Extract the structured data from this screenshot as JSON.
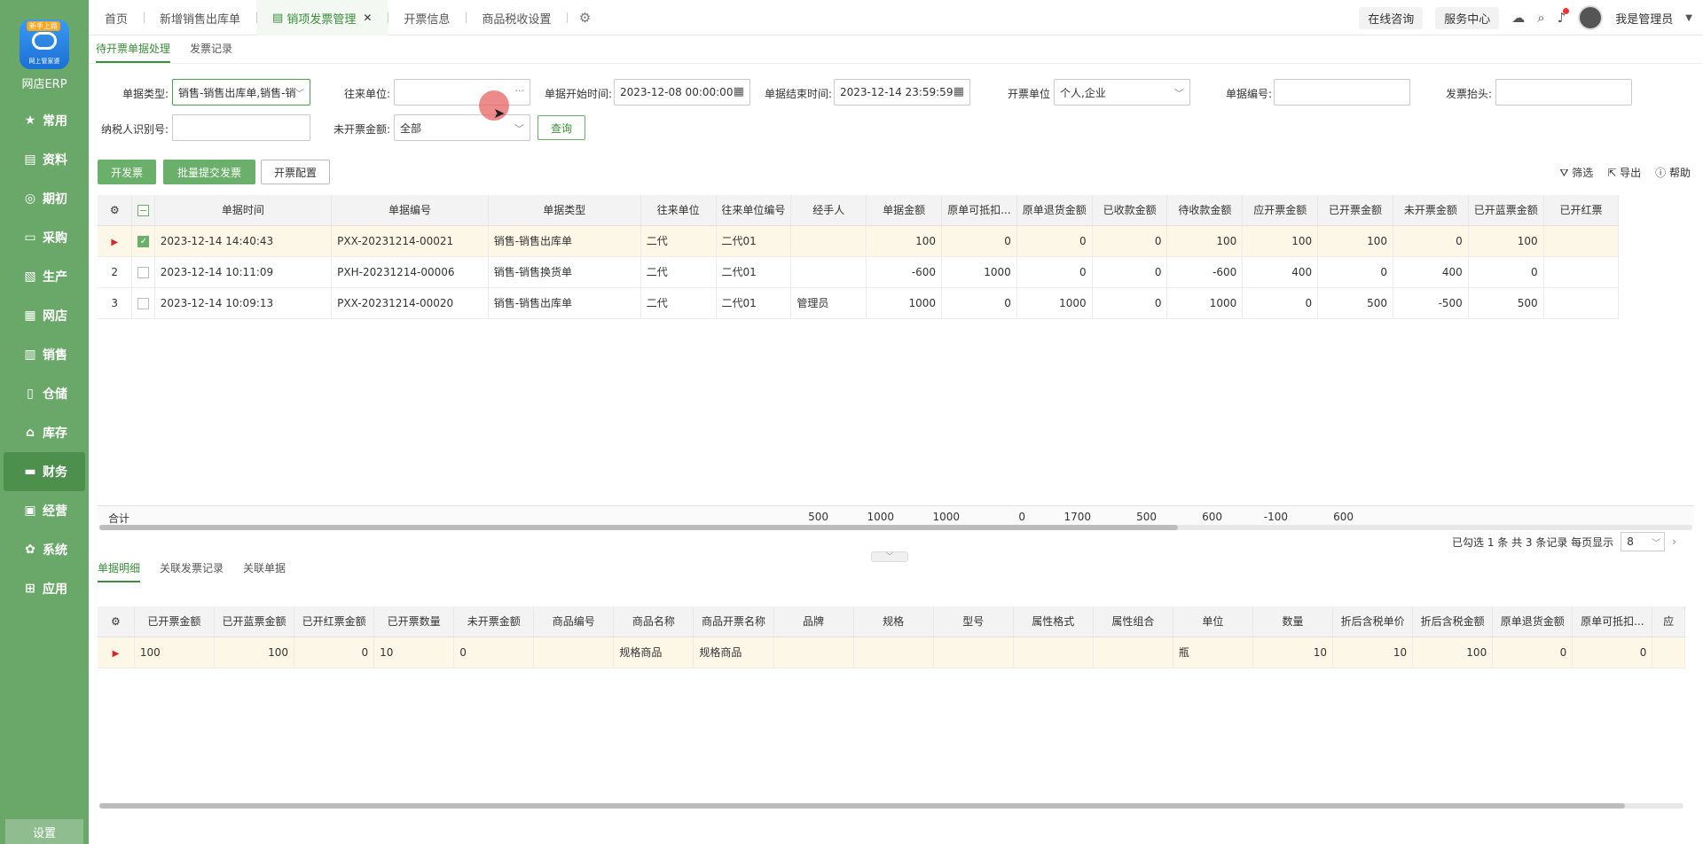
{
  "app": {
    "logo_badge": "新手上路",
    "logo_caption": "网上管家婆",
    "name": "网店ERP",
    "settings": "设置"
  },
  "nav": [
    {
      "label": "常用",
      "icon": "star-icon",
      "glyph": "★",
      "active": false
    },
    {
      "label": "资料",
      "icon": "document-icon",
      "glyph": "▤",
      "active": false
    },
    {
      "label": "期初",
      "icon": "cycle-icon",
      "glyph": "◎",
      "active": false
    },
    {
      "label": "采购",
      "icon": "monitor-icon",
      "glyph": "▭",
      "active": false
    },
    {
      "label": "生产",
      "icon": "file-icon",
      "glyph": "▧",
      "active": false
    },
    {
      "label": "网店",
      "icon": "store-icon",
      "glyph": "▦",
      "active": false
    },
    {
      "label": "销售",
      "icon": "chart-icon",
      "glyph": "▥",
      "active": false
    },
    {
      "label": "仓储",
      "icon": "warehouse-icon",
      "glyph": "▯",
      "active": false
    },
    {
      "label": "库存",
      "icon": "home-icon",
      "glyph": "⌂",
      "active": false
    },
    {
      "label": "财务",
      "icon": "wallet-icon",
      "glyph": "▬",
      "active": true
    },
    {
      "label": "经营",
      "icon": "image-icon",
      "glyph": "▣",
      "active": false
    },
    {
      "label": "系统",
      "icon": "gear-icon",
      "glyph": "✿",
      "active": false
    },
    {
      "label": "应用",
      "icon": "plus-square-icon",
      "glyph": "⊞",
      "active": false
    }
  ],
  "tabs": [
    {
      "label": "首页",
      "active": false
    },
    {
      "label": "新增销售出库单",
      "active": false
    },
    {
      "label": "销项发票管理",
      "active": true
    },
    {
      "label": "开票信息",
      "active": false
    },
    {
      "label": "商品税收设置",
      "active": false
    }
  ],
  "topright": {
    "consult": "在线咨询",
    "service": "服务中心",
    "user": "我是管理员"
  },
  "subtabs": [
    {
      "label": "待开票单据处理",
      "active": true
    },
    {
      "label": "发票记录",
      "active": false
    }
  ],
  "filters": {
    "doc_type_label": "单据类型:",
    "doc_type_value": "销售-销售出库单,销售-销",
    "partner_label": "往来单位:",
    "partner_value": "",
    "start_label": "单据开始时间:",
    "start_value": "2023-12-08 00:00:00",
    "end_label": "单据结束时间:",
    "end_value": "2023-12-14 23:59:59",
    "invoice_unit_label": "开票单位",
    "invoice_unit_value": "个人,企业",
    "doc_no_label": "单据编号:",
    "doc_no_value": "",
    "title_label": "发票抬头:",
    "title_value": "",
    "taxid_label": "纳税人识别号:",
    "taxid_value": "",
    "uninvoiced_label": "未开票金额:",
    "uninvoiced_value": "全部",
    "query": "查询"
  },
  "actions": {
    "issue": "开发票",
    "batch": "批量提交发票",
    "config": "开票配置",
    "filter": "筛选",
    "export": "导出",
    "help": "帮助"
  },
  "main_table": {
    "headers": [
      "单据时间",
      "单据编号",
      "单据类型",
      "往来单位",
      "往来单位编号",
      "经手人",
      "单据金额",
      "原单可抵扣...",
      "原单退货金额",
      "已收款金额",
      "待收款金额",
      "应开票金额",
      "已开票金额",
      "未开票金额",
      "已开蓝票金额",
      "已开红票"
    ],
    "rows": [
      {
        "no": "",
        "selected": true,
        "cells": [
          "2023-12-14 14:40:43",
          "PXX-20231214-00021",
          "销售-销售出库单",
          "二代",
          "二代01",
          "",
          "100",
          "0",
          "0",
          "0",
          "100",
          "100",
          "100",
          "0",
          "100",
          ""
        ]
      },
      {
        "no": "2",
        "selected": false,
        "cells": [
          "2023-12-14 10:11:09",
          "PXH-20231214-00006",
          "销售-销售换货单",
          "二代",
          "二代01",
          "",
          "-600",
          "1000",
          "0",
          "0",
          "-600",
          "400",
          "0",
          "400",
          "0",
          ""
        ]
      },
      {
        "no": "3",
        "selected": false,
        "cells": [
          "2023-12-14 10:09:13",
          "PXX-20231214-00020",
          "销售-销售出库单",
          "二代",
          "二代01",
          "管理员",
          "1000",
          "0",
          "1000",
          "0",
          "1000",
          "0",
          "500",
          "-500",
          "500",
          ""
        ]
      }
    ],
    "summary_label": "合计",
    "summary": [
      "500",
      "1000",
      "1000",
      "0",
      "1700",
      "500",
      "600",
      "-100",
      "600"
    ]
  },
  "pager": {
    "info": "已勾选 1 条  共 3 条记录  每页显示",
    "size": "8"
  },
  "bottom_tabs": [
    {
      "label": "单据明细",
      "active": true
    },
    {
      "label": "关联发票记录",
      "active": false
    },
    {
      "label": "关联单据",
      "active": false
    }
  ],
  "detail_table": {
    "headers": [
      "已开票金额",
      "已开蓝票金额",
      "已开红票金额",
      "已开票数量",
      "未开票金额",
      "商品编号",
      "商品名称",
      "商品开票名称",
      "品牌",
      "规格",
      "型号",
      "属性格式",
      "属性组合",
      "单位",
      "数量",
      "折后含税单价",
      "折后含税金额",
      "原单退货金额",
      "原单可抵扣...",
      "应"
    ],
    "rows": [
      {
        "cells": [
          "100",
          "100",
          "0",
          "10",
          "0",
          "",
          "规格商品",
          "规格商品",
          "",
          "",
          "",
          "",
          "",
          "瓶",
          "10",
          "10",
          "100",
          "0",
          "0",
          ""
        ]
      }
    ]
  }
}
